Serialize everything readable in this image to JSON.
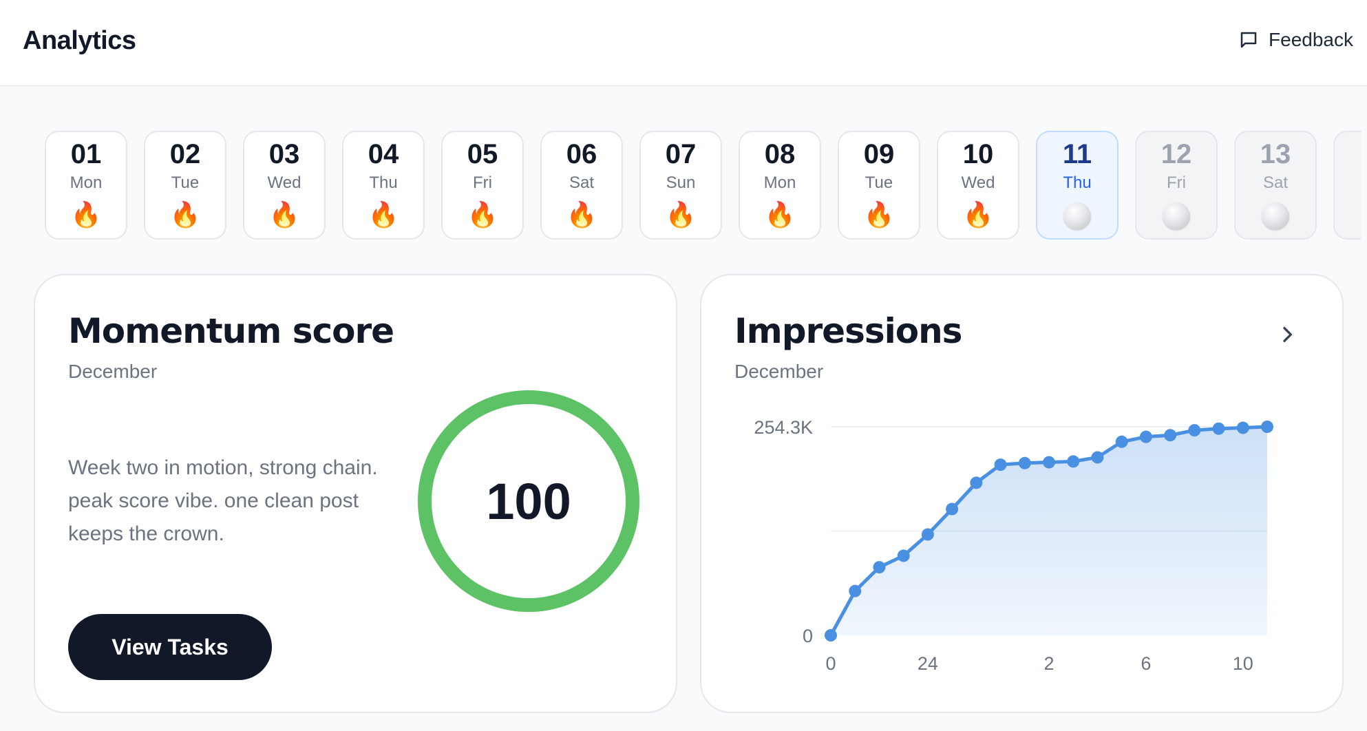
{
  "header": {
    "title": "Analytics",
    "feedback_label": "Feedback"
  },
  "days": [
    {
      "num": "01",
      "dow": "Mon",
      "mark": "🔥",
      "state": "done"
    },
    {
      "num": "02",
      "dow": "Tue",
      "mark": "🔥",
      "state": "done"
    },
    {
      "num": "03",
      "dow": "Wed",
      "mark": "🔥",
      "state": "done"
    },
    {
      "num": "04",
      "dow": "Thu",
      "mark": "🔥",
      "state": "done"
    },
    {
      "num": "05",
      "dow": "Fri",
      "mark": "🔥",
      "state": "done"
    },
    {
      "num": "06",
      "dow": "Sat",
      "mark": "🔥",
      "state": "done"
    },
    {
      "num": "07",
      "dow": "Sun",
      "mark": "🔥",
      "state": "done"
    },
    {
      "num": "08",
      "dow": "Mon",
      "mark": "🔥",
      "state": "done"
    },
    {
      "num": "09",
      "dow": "Tue",
      "mark": "🔥",
      "state": "done"
    },
    {
      "num": "10",
      "dow": "Wed",
      "mark": "🔥",
      "state": "done"
    },
    {
      "num": "11",
      "dow": "Thu",
      "mark": "",
      "state": "active"
    },
    {
      "num": "12",
      "dow": "Fri",
      "mark": "",
      "state": "future"
    },
    {
      "num": "13",
      "dow": "Sat",
      "mark": "",
      "state": "future"
    }
  ],
  "momentum": {
    "title": "Momentum score",
    "subtitle": "December",
    "description": "Week two in motion, strong chain. peak score vibe. one clean post keeps the crown.",
    "score": "100",
    "score_fraction": 1.0,
    "ring_color": "#5cc265",
    "button_label": "View Tasks"
  },
  "impressions": {
    "title": "Impressions",
    "subtitle": "December"
  },
  "chart_data": {
    "type": "area",
    "title": "Impressions",
    "subtitle": "December",
    "xlabel": "",
    "ylabel": "",
    "y_tick_labels": [
      "0",
      "254.3K"
    ],
    "y_ticks": [
      0,
      254300
    ],
    "ylim": [
      0,
      254300
    ],
    "x_tick_labels": [
      {
        "index": 0,
        "label": "0"
      },
      {
        "index": 4,
        "label": "24"
      },
      {
        "index": 9,
        "label": "2"
      },
      {
        "index": 13,
        "label": "6"
      },
      {
        "index": 17,
        "label": "10"
      }
    ],
    "grid": true,
    "series": [
      {
        "values": [
          0,
          54000,
          83000,
          97000,
          123000,
          154000,
          186000,
          208000,
          210000,
          211000,
          212000,
          217000,
          236000,
          242000,
          244000,
          250000,
          252000,
          253000,
          254300
        ],
        "color": "#4a90e2"
      }
    ]
  }
}
